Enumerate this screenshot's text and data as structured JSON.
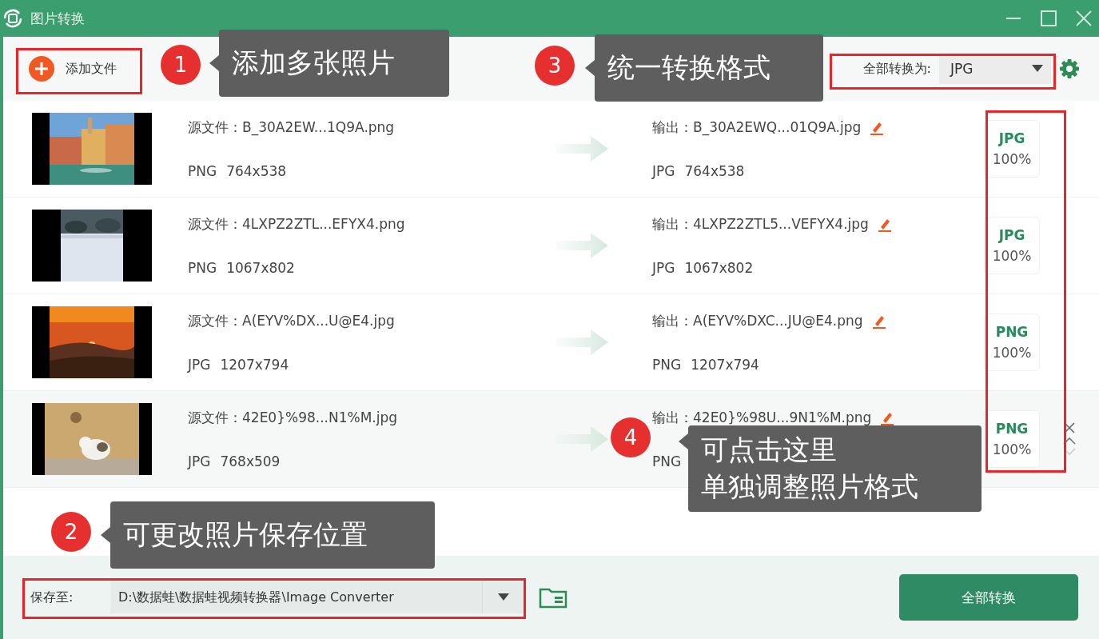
{
  "window": {
    "title": "图片转换"
  },
  "toolbar": {
    "add_button": "添加文件",
    "convert_all_label": "全部转换为:",
    "convert_all_value": "JPG"
  },
  "files": [
    {
      "kind": "picture",
      "source": "源文件：B_30A2EW...1Q9A.png",
      "src_format": "PNG",
      "src_size": "764x538",
      "output": "输出：B_30A2EWQ...01Q9A.jpg",
      "out_format": "JPG",
      "out_size": "764x538",
      "badge_format": "JPG",
      "quality": "100%",
      "hovered": false
    },
    {
      "kind": "picture",
      "source": "源文件：4LXPZ2ZTL...EFYX4.png",
      "src_format": "PNG",
      "src_size": "1067x802",
      "output": "输出：4LXPZ2ZTL5...VEFYX4.jpg",
      "out_format": "JPG",
      "out_size": "1067x802",
      "badge_format": "JPG",
      "quality": "100%",
      "hovered": false
    },
    {
      "kind": "picture",
      "source": "源文件：A(EYV%DX...U@E4.jpg",
      "src_format": "JPG",
      "src_size": "1207x794",
      "output": "输出：A(EYV%DXC...JU@E4.png",
      "out_format": "PNG",
      "out_size": "1207x794",
      "badge_format": "PNG",
      "quality": "100%",
      "hovered": false
    },
    {
      "kind": "picture",
      "source": "源文件：42E0}%98...N1%M.jpg",
      "src_format": "JPG",
      "src_size": "768x509",
      "output": "输出：42E0}%98U...9N1%M.png",
      "out_format": "PNG",
      "badge_format": "PNG",
      "quality": "100%",
      "hovered": true
    }
  ],
  "footer": {
    "save_label": "保存至:",
    "save_path": "D:\\数据蛙\\数据蛙视频转换器\\Image Converter",
    "convert_button": "全部转换"
  },
  "annotations": [
    {
      "number": "1",
      "lines": [
        "添加多张照片"
      ]
    },
    {
      "number": "2",
      "lines": [
        "可更改照片保存位置"
      ]
    },
    {
      "number": "3",
      "lines": [
        "统一转换格式"
      ]
    },
    {
      "number": "4",
      "lines": [
        "可点击这里",
        "单独调整照片格式"
      ]
    }
  ]
}
